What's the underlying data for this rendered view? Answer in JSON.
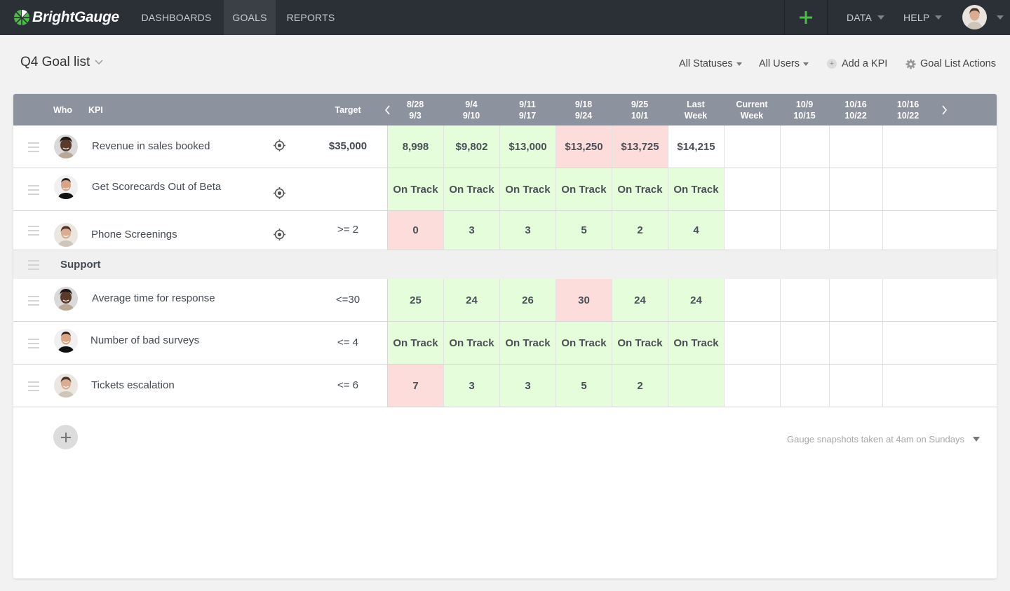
{
  "nav": {
    "brand": "BrightGauge",
    "items": [
      {
        "label": "DASHBOARDS",
        "active": false
      },
      {
        "label": "GOALS",
        "active": true
      },
      {
        "label": "REPORTS",
        "active": false
      }
    ],
    "right": [
      {
        "label": "DATA"
      },
      {
        "label": "HELP"
      }
    ],
    "accent_color": "#4cbb47"
  },
  "page": {
    "title": "Q4 Goal list",
    "actions": {
      "statuses": "All Statuses",
      "users": "All Users",
      "add_kpi": "Add a KPI",
      "goal_list_actions": "Goal List Actions"
    }
  },
  "table": {
    "headers": {
      "who": "Who",
      "kpi": "KPI",
      "target": "Target"
    },
    "periods": [
      {
        "top": "8/28",
        "bottom": "9/3"
      },
      {
        "top": "9/4",
        "bottom": "9/10"
      },
      {
        "top": "9/11",
        "bottom": "9/17"
      },
      {
        "top": "9/18",
        "bottom": "9/24"
      },
      {
        "top": "9/25",
        "bottom": "10/1"
      },
      {
        "top": "Last",
        "bottom": "Week"
      },
      {
        "top": "Current",
        "bottom": "Week"
      },
      {
        "top": "10/9",
        "bottom": "10/15"
      },
      {
        "top": "10/16",
        "bottom": "10/22"
      },
      {
        "top": "10/16",
        "bottom": "10/22"
      }
    ],
    "rows": [
      {
        "type": "kpi",
        "name": "Revenue in sales booked",
        "avatar": "person-1",
        "has_target_icon": true,
        "target": "$35,000",
        "values": [
          {
            "v": "8,998",
            "s": "green"
          },
          {
            "v": "$9,802",
            "s": "green"
          },
          {
            "v": "$13,000",
            "s": "green"
          },
          {
            "v": "$13,250",
            "s": "red"
          },
          {
            "v": "$13,725",
            "s": "red"
          },
          {
            "v": "$14,215",
            "s": "none"
          },
          {
            "v": "",
            "s": "none"
          },
          {
            "v": "",
            "s": "none"
          },
          {
            "v": "",
            "s": "none"
          },
          {
            "v": "",
            "s": "none"
          }
        ]
      },
      {
        "type": "kpi",
        "name": "Get Scorecards Out of Beta",
        "avatar": "person-2",
        "has_target_icon": true,
        "target": "",
        "values": [
          {
            "v": "On Track",
            "s": "green"
          },
          {
            "v": "On Track",
            "s": "green"
          },
          {
            "v": "On Track",
            "s": "green"
          },
          {
            "v": "On Track",
            "s": "green"
          },
          {
            "v": "On Track",
            "s": "green"
          },
          {
            "v": "On Track",
            "s": "green"
          },
          {
            "v": "",
            "s": "none"
          },
          {
            "v": "",
            "s": "none"
          },
          {
            "v": "",
            "s": "none"
          },
          {
            "v": "",
            "s": "none"
          }
        ]
      },
      {
        "type": "kpi",
        "name": "Phone Screenings",
        "avatar": "person-3",
        "has_target_icon": true,
        "target": ">= 2",
        "values": [
          {
            "v": "0",
            "s": "red"
          },
          {
            "v": "3",
            "s": "green"
          },
          {
            "v": "3",
            "s": "green"
          },
          {
            "v": "5",
            "s": "green"
          },
          {
            "v": "2",
            "s": "green"
          },
          {
            "v": "4",
            "s": "green"
          },
          {
            "v": "",
            "s": "none"
          },
          {
            "v": "",
            "s": "none"
          },
          {
            "v": "",
            "s": "none"
          },
          {
            "v": "",
            "s": "none"
          }
        ]
      },
      {
        "type": "group",
        "name": "Support"
      },
      {
        "type": "kpi",
        "name": "Average time for response",
        "avatar": "person-1",
        "has_target_icon": false,
        "target": "<=30",
        "values": [
          {
            "v": "25",
            "s": "green"
          },
          {
            "v": "24",
            "s": "green"
          },
          {
            "v": "26",
            "s": "green"
          },
          {
            "v": "30",
            "s": "red"
          },
          {
            "v": "24",
            "s": "green"
          },
          {
            "v": "24",
            "s": "green"
          },
          {
            "v": "",
            "s": "none"
          },
          {
            "v": "",
            "s": "none"
          },
          {
            "v": "",
            "s": "none"
          },
          {
            "v": "",
            "s": "none"
          }
        ]
      },
      {
        "type": "kpi",
        "name": "Number of bad surveys",
        "avatar": "person-2",
        "has_target_icon": false,
        "target": "<= 4",
        "values": [
          {
            "v": "On Track",
            "s": "green"
          },
          {
            "v": "On Track",
            "s": "green"
          },
          {
            "v": "On Track",
            "s": "green"
          },
          {
            "v": "On Track",
            "s": "green"
          },
          {
            "v": "On Track",
            "s": "green"
          },
          {
            "v": "On Track",
            "s": "green"
          },
          {
            "v": "",
            "s": "none"
          },
          {
            "v": "",
            "s": "none"
          },
          {
            "v": "",
            "s": "none"
          },
          {
            "v": "",
            "s": "none"
          }
        ]
      },
      {
        "type": "kpi",
        "name": "Tickets escalation",
        "avatar": "person-3",
        "has_target_icon": false,
        "target": "<= 6",
        "values": [
          {
            "v": "7",
            "s": "red"
          },
          {
            "v": "3",
            "s": "green"
          },
          {
            "v": "3",
            "s": "green"
          },
          {
            "v": "5",
            "s": "green"
          },
          {
            "v": "2",
            "s": "green"
          },
          {
            "v": "",
            "s": "green"
          },
          {
            "v": "",
            "s": "none"
          },
          {
            "v": "",
            "s": "none"
          },
          {
            "v": "",
            "s": "none"
          },
          {
            "v": "",
            "s": "none"
          }
        ]
      }
    ]
  },
  "footer": {
    "snapshot_note": "Gauge snapshots taken at 4am on Sundays"
  },
  "status_colors": {
    "green": "#e6fddc",
    "red": "#fddcdc"
  }
}
